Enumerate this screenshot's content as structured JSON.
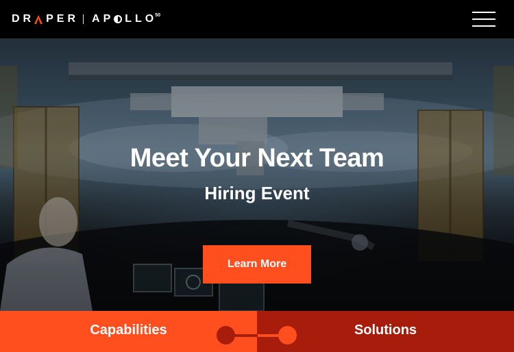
{
  "header": {
    "brand_primary": "DR",
    "brand_primary_rest": "PER",
    "brand_secondary_start": "AP",
    "brand_secondary_end": "LLO",
    "brand_superscript": "50",
    "menu_icon": "hamburger-menu-icon"
  },
  "hero": {
    "title": "Meet Your Next Team",
    "subtitle": "Hiring Event",
    "cta_label": "Learn More"
  },
  "tabs": {
    "left_label": "Capabilities",
    "right_label": "Solutions"
  },
  "colors": {
    "accent": "#ff4f1f",
    "accent_dark": "#a81c0c",
    "header_bg": "#000000",
    "text": "#ffffff"
  }
}
